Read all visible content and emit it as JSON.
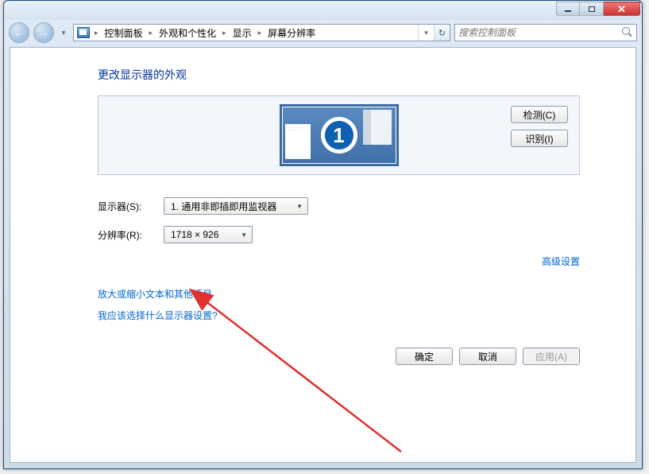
{
  "breadcrumb": {
    "items": [
      "控制面板",
      "外观和个性化",
      "显示",
      "屏幕分辨率"
    ]
  },
  "search": {
    "placeholder": "搜索控制面板"
  },
  "heading": "更改显示器的外观",
  "monitor_number": "1",
  "side_buttons": {
    "detect": "检测(C)",
    "identify": "识别(I)"
  },
  "fields": {
    "display_label": "显示器(S):",
    "display_value": "1. 通用非即插即用监视器",
    "resolution_label": "分辨率(R):",
    "resolution_value": "1718 × 926"
  },
  "links": {
    "advanced": "高级设置",
    "text_size": "放大或缩小文本和其他项目",
    "which_settings": "我应该选择什么显示器设置?"
  },
  "actions": {
    "ok": "确定",
    "cancel": "取消",
    "apply": "应用(A)"
  }
}
